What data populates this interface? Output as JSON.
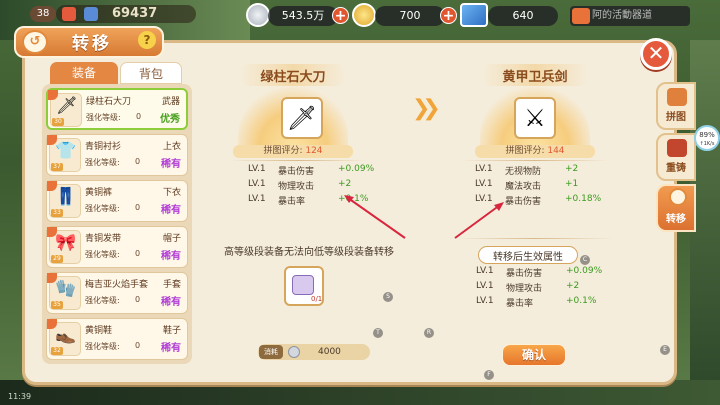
{
  "hud": {
    "level": "38",
    "power": "69437",
    "silver": "543.5万",
    "gold": "700",
    "tickets": "640",
    "notice": "阿的活動器道"
  },
  "panel": {
    "title": "转移",
    "tabs": [
      "装备",
      "背包"
    ]
  },
  "items": [
    {
      "name": "绿柱石大刀",
      "type": "武器",
      "strength_label": "强化等级:",
      "strength": "0",
      "badge": "优秀",
      "badge_color": "#48a01f",
      "level": "30",
      "glyph": "🗡"
    },
    {
      "name": "青铜衬衫",
      "type": "上衣",
      "strength_label": "强化等级:",
      "strength": "0",
      "badge": "稀有",
      "badge_color": "#b13dd6",
      "level": "37",
      "glyph": "👕"
    },
    {
      "name": "黄铜裤",
      "type": "下衣",
      "strength_label": "强化等级:",
      "strength": "0",
      "badge": "稀有",
      "badge_color": "#b13dd6",
      "level": "33",
      "glyph": "👖"
    },
    {
      "name": "青铜发带",
      "type": "帽子",
      "strength_label": "强化等级:",
      "strength": "0",
      "badge": "稀有",
      "badge_color": "#b13dd6",
      "level": "29",
      "glyph": "🎀"
    },
    {
      "name": "梅吉亚火焰手套",
      "type": "手套",
      "strength_label": "强化等级:",
      "strength": "0",
      "badge": "稀有",
      "badge_color": "#b13dd6",
      "level": "35",
      "glyph": "🧤"
    },
    {
      "name": "黄铜鞋",
      "type": "鞋子",
      "strength_label": "强化等级:",
      "strength": "0",
      "badge": "稀有",
      "badge_color": "#b13dd6",
      "level": "32",
      "glyph": "👞"
    }
  ],
  "source": {
    "name": "绿柱石大刀",
    "score_label": "拼图评分:",
    "score": "124",
    "stats": [
      {
        "lv": "LV.1",
        "name": "暴击伤害",
        "value": "+0.09%"
      },
      {
        "lv": "LV.1",
        "name": "物理攻击",
        "value": "+2"
      },
      {
        "lv": "LV.1",
        "name": "暴击率",
        "value": "+0.1%"
      }
    ]
  },
  "target": {
    "name": "黄甲卫兵剑",
    "score_label": "拼图评分:",
    "score": "144",
    "stats": [
      {
        "lv": "LV.1",
        "name": "无视物防",
        "value": "+2"
      },
      {
        "lv": "LV.1",
        "name": "魔法攻击",
        "value": "+1"
      },
      {
        "lv": "LV.1",
        "name": "暴击伤害",
        "value": "+0.18%"
      }
    ]
  },
  "after": {
    "title": "转移后生效属性",
    "stats": [
      {
        "lv": "LV.1",
        "name": "暴击伤害",
        "value": "+0.09%"
      },
      {
        "lv": "LV.1",
        "name": "物理攻击",
        "value": "+2"
      },
      {
        "lv": "LV.1",
        "name": "暴击率",
        "value": "+0.1%"
      }
    ]
  },
  "warning": "高等级段装备无法向低等级段装备转移",
  "material": {
    "count": "0/1"
  },
  "cost": {
    "label": "消耗",
    "value": "4000"
  },
  "confirm": "确认",
  "side_tabs": [
    {
      "label": "拼图",
      "icon": "puzzle-icon"
    },
    {
      "label": "重铸",
      "icon": "anvil-icon"
    },
    {
      "label": "转移",
      "icon": "transfer-icon"
    }
  ],
  "gauge": {
    "percent": "89%",
    "speed": "↑1K/s"
  },
  "status": "11:39",
  "colors": {
    "accent": "#e38742",
    "positive": "#3a9a1e",
    "rare": "#b13dd6",
    "excellent": "#48a01f"
  }
}
